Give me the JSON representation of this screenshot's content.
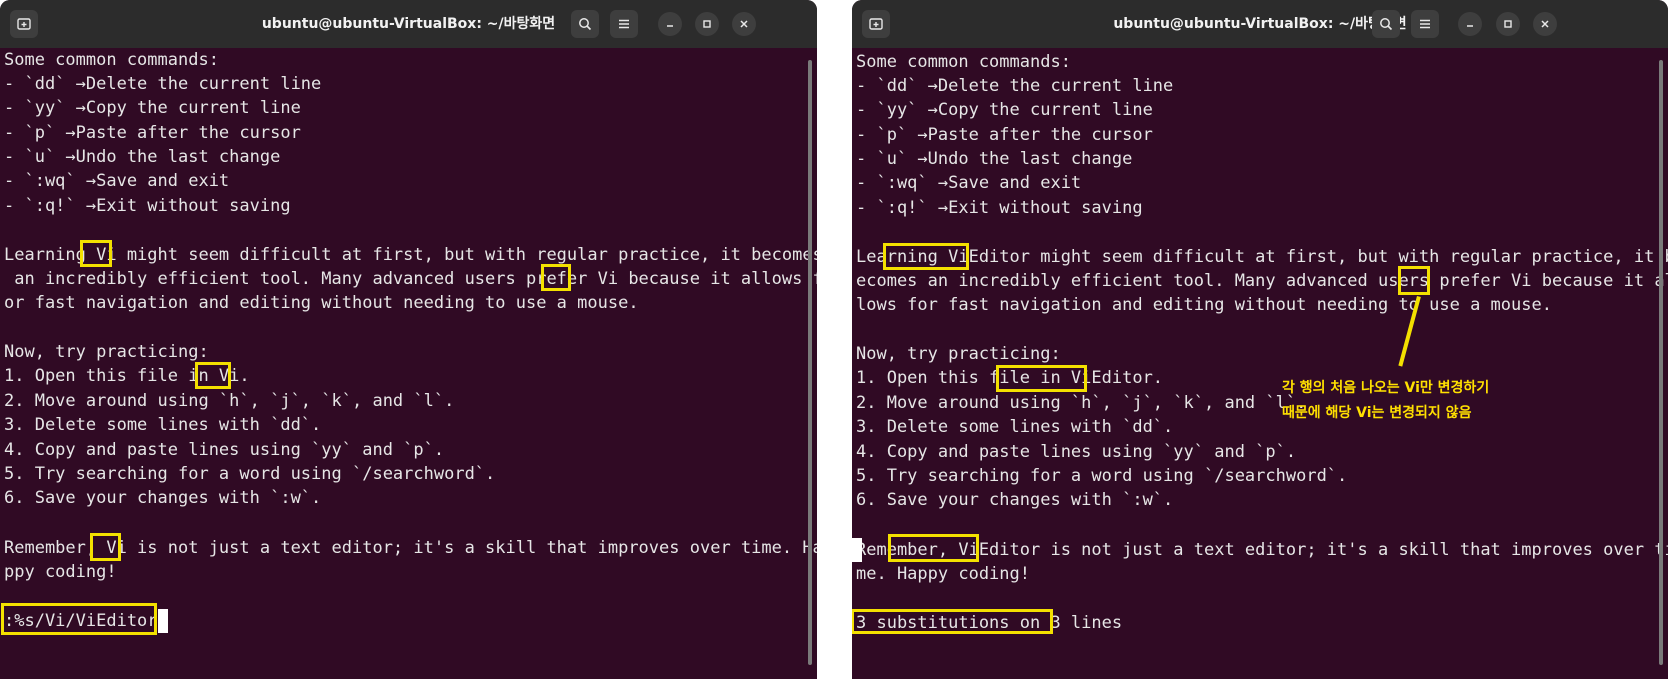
{
  "left_window": {
    "title": "ubuntu@ubuntu-VirtualBox: ~/바탕화면",
    "lines": [
      "Some common commands:",
      "- `dd` →Delete the current line",
      "- `yy` →Copy the current line",
      "- `p` →Paste after the cursor",
      "- `u` →Undo the last change",
      "- `:wq` →Save and exit",
      "- `:q!` →Exit without saving",
      "",
      "Learning Vi might seem difficult at first, but with regular practice, it becomes",
      " an incredibly efficient tool. Many advanced users prefer Vi because it allows f",
      "or fast navigation and editing without needing to use a mouse.",
      "",
      "Now, try practicing:",
      "1. Open this file in Vi.",
      "2. Move around using `h`, `j`, `k`, and `l`.",
      "3. Delete some lines with `dd`.",
      "4. Copy and paste lines using `yy` and `p`.",
      "5. Try searching for a word using `/searchword`.",
      "6. Save your changes with `:w`.",
      "",
      "Remember, Vi is not just a text editor; it's a skill that improves over time. Ha",
      "ppy coding!"
    ],
    "command_line": ":%s/Vi/ViEditor"
  },
  "right_window": {
    "title": "ubuntu@ubuntu-VirtualBox: ~/바탕화면",
    "lines": [
      "Some common commands:",
      "- `dd` →Delete the current line",
      "- `yy` →Copy the current line",
      "- `p` →Paste after the cursor",
      "- `u` →Undo the last change",
      "- `:wq` →Save and exit",
      "- `:q!` →Exit without saving",
      "",
      "Learning ViEditor might seem difficult at first, but with regular practice, it b",
      "ecomes an incredibly efficient tool. Many advanced users prefer Vi because it al",
      "lows for fast navigation and editing without needing to use a mouse.",
      "",
      "Now, try practicing:",
      "1. Open this file in ViEditor.",
      "2. Move around using `h`, `j`, `k`, and `l`.",
      "3. Delete some lines with `dd`.",
      "4. Copy and paste lines using `yy` and `p`.",
      "5. Try searching for a word using `/searchword`.",
      "6. Save your changes with `:w`.",
      "",
      "Remember, ViEditor is not just a text editor; it's a skill that improves over ti",
      "me. Happy coding!"
    ],
    "status_line": "3 substitutions on 3 lines",
    "annotation": [
      "각 행의 처음 나오는 Vi만 변경하기",
      "때문에 해당 Vi는 변경되지 않음"
    ]
  },
  "colors": {
    "terminal_bg": "#300a24",
    "titlebar_bg": "#2c2c2c",
    "text": "#e6e6e6",
    "highlight": "#f3e000"
  },
  "icons": [
    "new-tab-icon",
    "search-icon",
    "menu-icon",
    "minimize-icon",
    "maximize-icon",
    "close-icon"
  ]
}
